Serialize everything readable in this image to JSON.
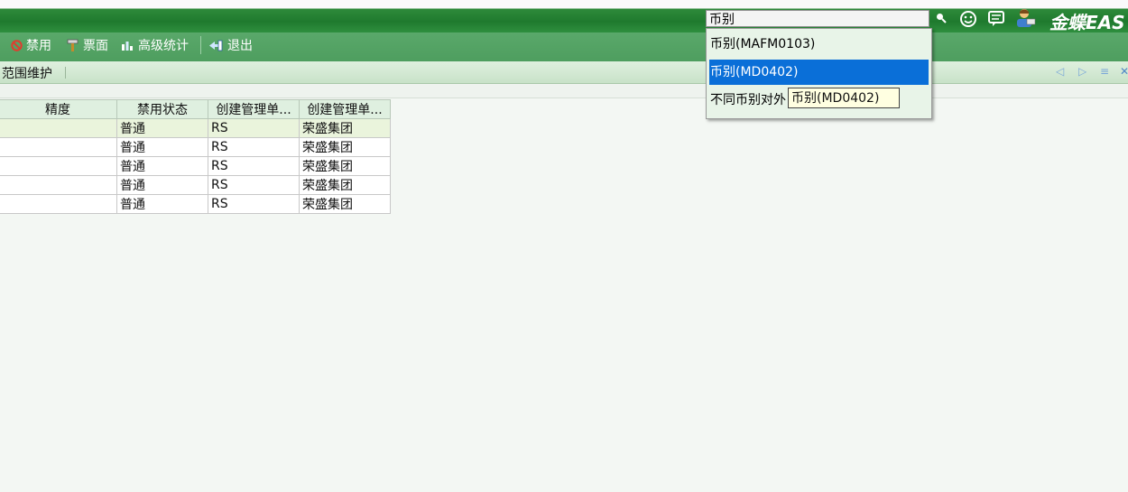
{
  "toolbar": {
    "disable_label": "禁用",
    "ticket_label": "票面",
    "stats_label": "高级统计",
    "exit_label": "退出"
  },
  "tab": {
    "title": "范围维护"
  },
  "grid": {
    "columns": [
      "精度",
      "禁用状态",
      "创建管理单...",
      "创建管理单..."
    ],
    "rows": [
      [
        "",
        "普通",
        "RS",
        "荣盛集团"
      ],
      [
        "",
        "普通",
        "RS",
        "荣盛集团"
      ],
      [
        "",
        "普通",
        "RS",
        "荣盛集团"
      ],
      [
        "",
        "普通",
        "RS",
        "荣盛集团"
      ],
      [
        "",
        "普通",
        "RS",
        "荣盛集团"
      ]
    ]
  },
  "search": {
    "value": "币别",
    "suggestions": [
      "币别(MAFM0103)",
      "币别(MD0402)",
      "不同币别对外"
    ],
    "tooltip": "币别(MD0402)"
  },
  "brand": {
    "text": "金蝶EAS"
  },
  "colors": {
    "title_green": "#1f7a2e",
    "toolbar_green": "#4e9e5f",
    "select_blue": "#0a6fd8"
  }
}
